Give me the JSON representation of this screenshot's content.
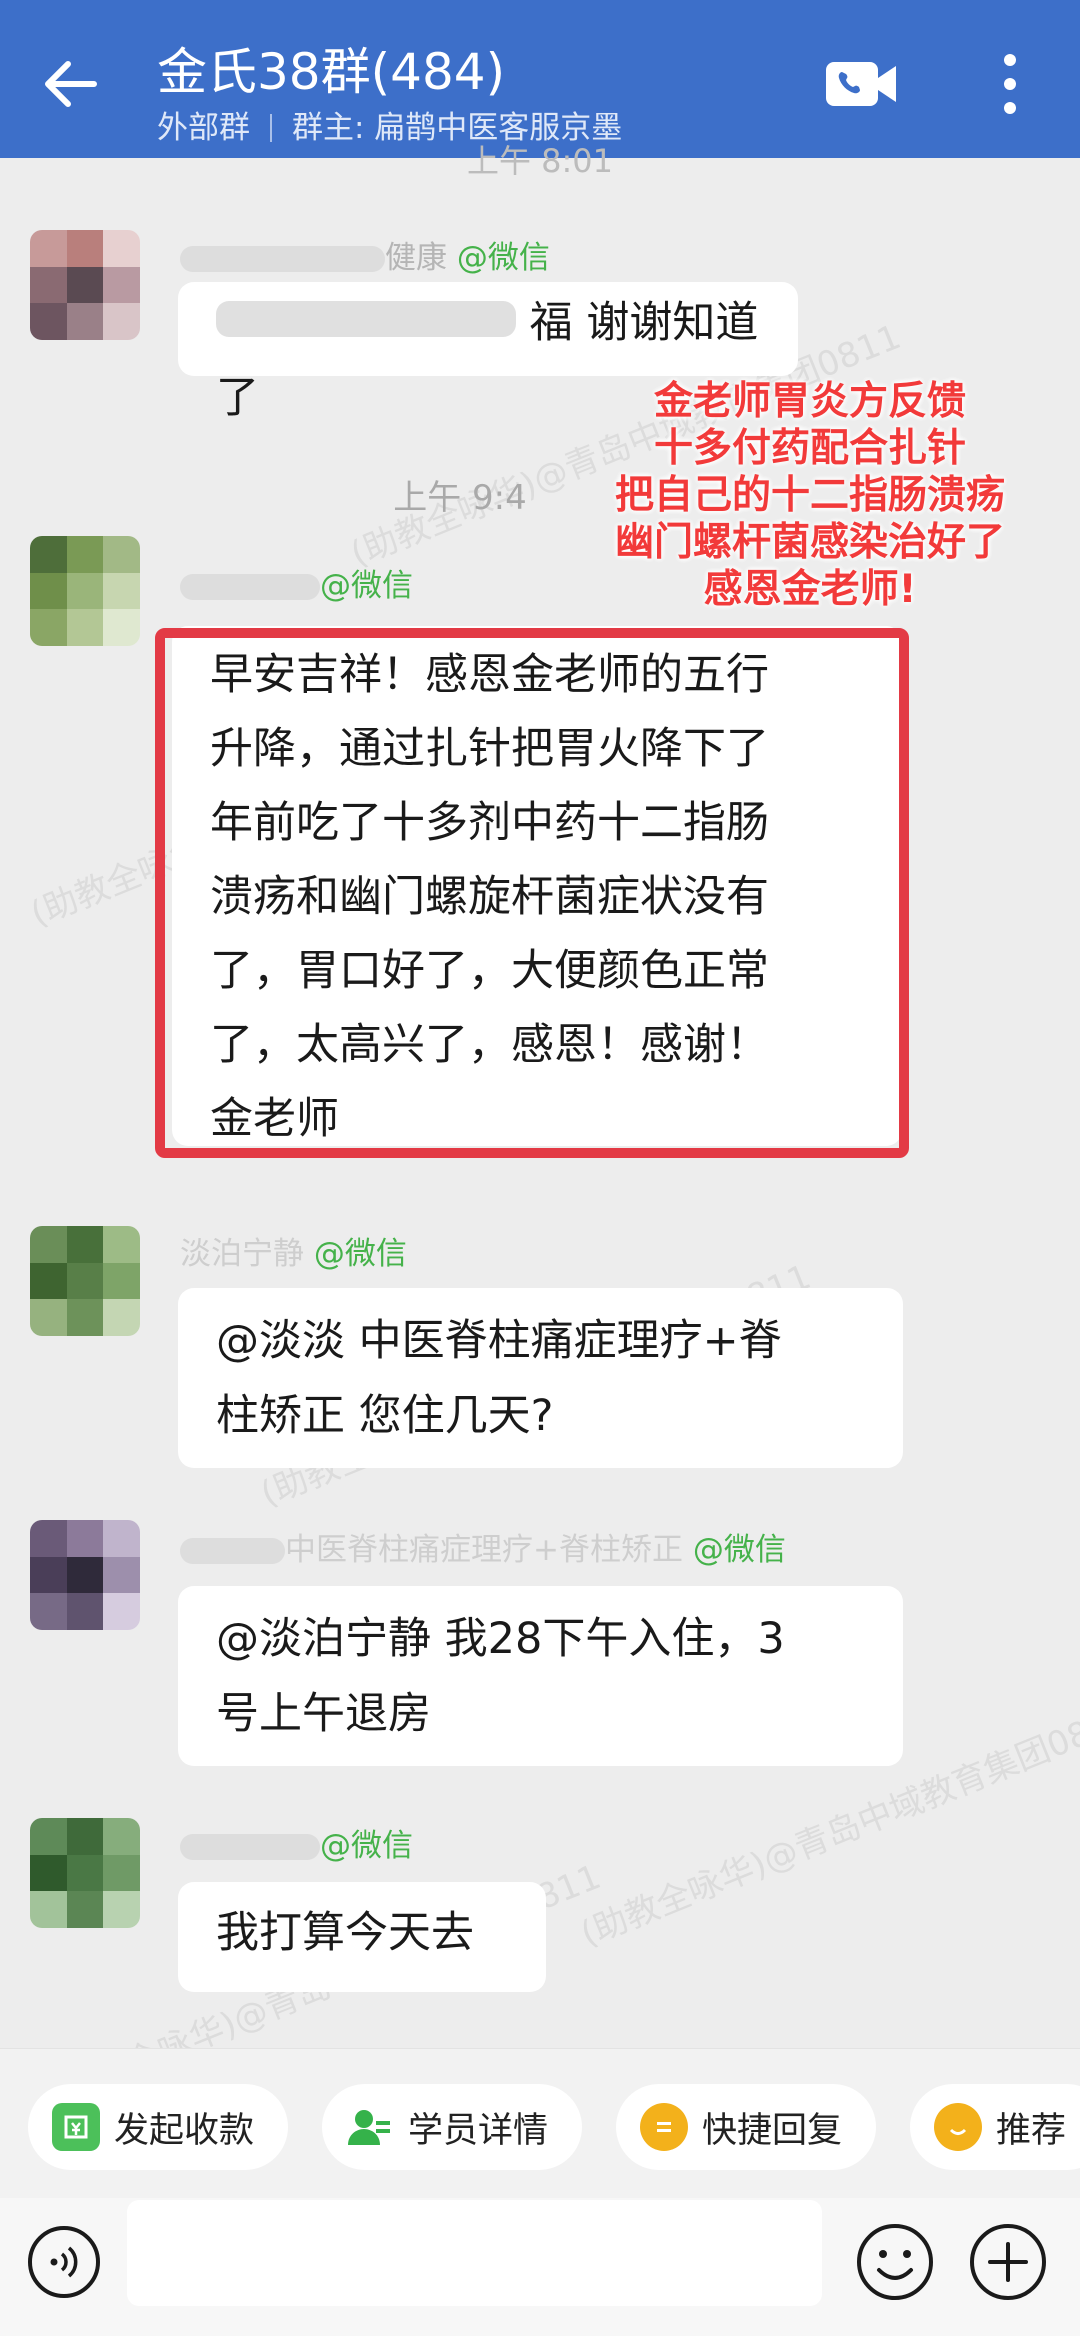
{
  "header": {
    "title": "金氏38群(484)",
    "subtitle_type": "外部群",
    "subtitle_owner": "群主: 扁鹊中医客服京墨"
  },
  "timestamps": [
    "上午 8:01",
    "上午 9:4"
  ],
  "messages": [
    {
      "sender_visible": "健康",
      "source_tag": "@微信",
      "text": "福 谢谢知道了"
    },
    {
      "sender_visible": "",
      "source_tag": "@微信",
      "lines": [
        "早安吉祥！感恩金老师的五行",
        "升降，通过扎针把胃火降下了",
        "年前吃了十多剂中药十二指肠",
        "溃疡和幽门螺旋杆菌症状没有",
        "了，胃口好了，大便颜色正常",
        "了，太高兴了，感恩！感谢！",
        "金老师"
      ]
    },
    {
      "sender_visible": "淡泊宁静",
      "source_tag": "@微信",
      "lines": [
        "@淡淡   中医脊柱痛症理疗+脊",
        "柱矫正 您住几天?"
      ]
    },
    {
      "sender_visible": "中医脊柱痛症理疗+脊柱矫正",
      "source_tag": "@微信",
      "lines": [
        "@淡泊宁静 我28下午入住，3",
        "号上午退房"
      ]
    },
    {
      "sender_visible": "",
      "source_tag": "@微信",
      "text": "我打算今天去"
    }
  ],
  "annotation": {
    "lines": [
      "金老师胃炎方反馈",
      "十多付药配合扎针",
      "把自己的十二指肠溃疡",
      "幽门螺杆菌感染治好了",
      "感恩金老师!"
    ],
    "color": "#f23a3a"
  },
  "watermark_text": "(助教全咏华)@青岛中域教育集团0811",
  "quick_actions": [
    {
      "label": "发起收款",
      "icon": "payment-icon"
    },
    {
      "label": "学员详情",
      "icon": "student-icon"
    },
    {
      "label": "快捷回复",
      "icon": "quick-reply-icon"
    },
    {
      "label": "推荐",
      "icon": "recommend-icon"
    }
  ],
  "colors": {
    "header": "#3d6fc9",
    "wechat_tag": "#45b24a",
    "highlight_border": "#e33a45"
  }
}
